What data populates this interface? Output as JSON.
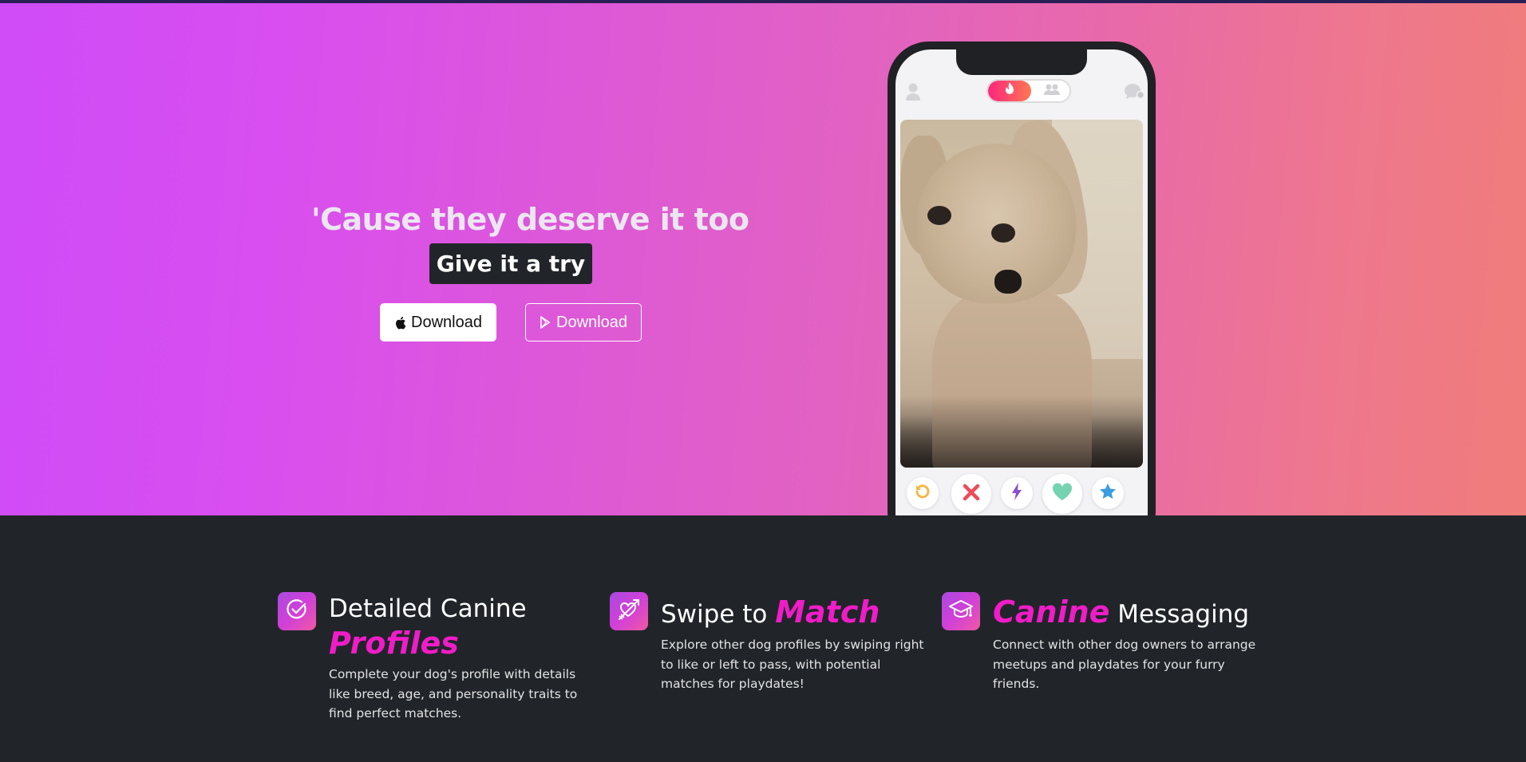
{
  "hero": {
    "headline": "'Cause they deserve it too",
    "cta_label": "Give it a try",
    "download_apple_label": "Download",
    "download_play_label": "Download"
  },
  "phone": {
    "actions": [
      "rewind-icon",
      "nope-icon",
      "boost-icon",
      "like-icon",
      "super-like-icon"
    ]
  },
  "features": [
    {
      "icon": "check-circle-icon",
      "title_plain": "Detailed Canine",
      "title_accent": "Profiles",
      "text": "Complete your dog's profile with details like breed, age, and personality traits to find perfect matches."
    },
    {
      "icon": "heart-arrow-icon",
      "title_plain": "Swipe to",
      "title_accent": "Match",
      "text": "Explore other dog profiles by swiping right to like or left to pass, with potential matches for playdates!"
    },
    {
      "icon": "graduation-cap-icon",
      "title_plain": "Messaging",
      "title_accent": "Canine",
      "text": "Connect with other dog owners to arrange meetups and playdates for your furry friends."
    }
  ],
  "colors": {
    "accent": "#f01cc8",
    "dark_bg": "#212529",
    "hero_gradient_start": "#cf4cf7",
    "hero_gradient_end": "#f07d7a"
  }
}
